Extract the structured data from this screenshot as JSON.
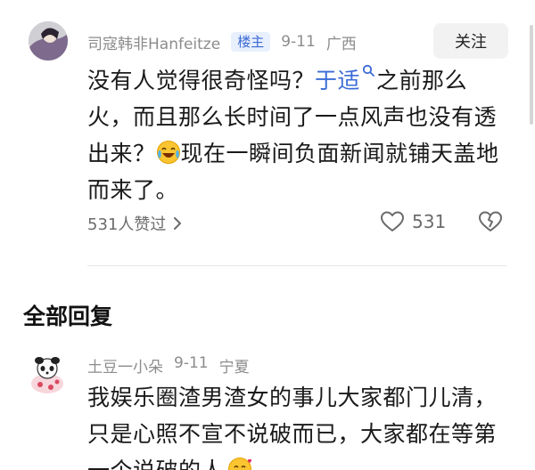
{
  "post": {
    "author": "司寇韩非Hanfeitze",
    "badge": "楼主",
    "date": "9-11",
    "location": "广西",
    "follow_label": "关注",
    "text_1": "没有人觉得很奇怪吗？",
    "mention": "于适",
    "text_2": "之前那么火，而且那么长时间了一点风声也没有透出来？",
    "text_3": "现在一瞬间负面新闻就铺天盖地而来了。",
    "likers": "531人赞过",
    "like_count": "531",
    "emoji_inline": "laughing-crying-emoji"
  },
  "section": {
    "title": "全部回复"
  },
  "reply": {
    "author": "土豆一小朵",
    "date": "9-11",
    "location": "宁夏",
    "text": "我娱乐圈渣男渣女的事儿大家都门儿清，只是心照不宣不说破而已，大家都在等第一个说破的人",
    "emoji_inline": "smiling-hearts-emoji"
  },
  "colors": {
    "accent": "#3a6bd6",
    "muted": "#8c8c8c"
  }
}
